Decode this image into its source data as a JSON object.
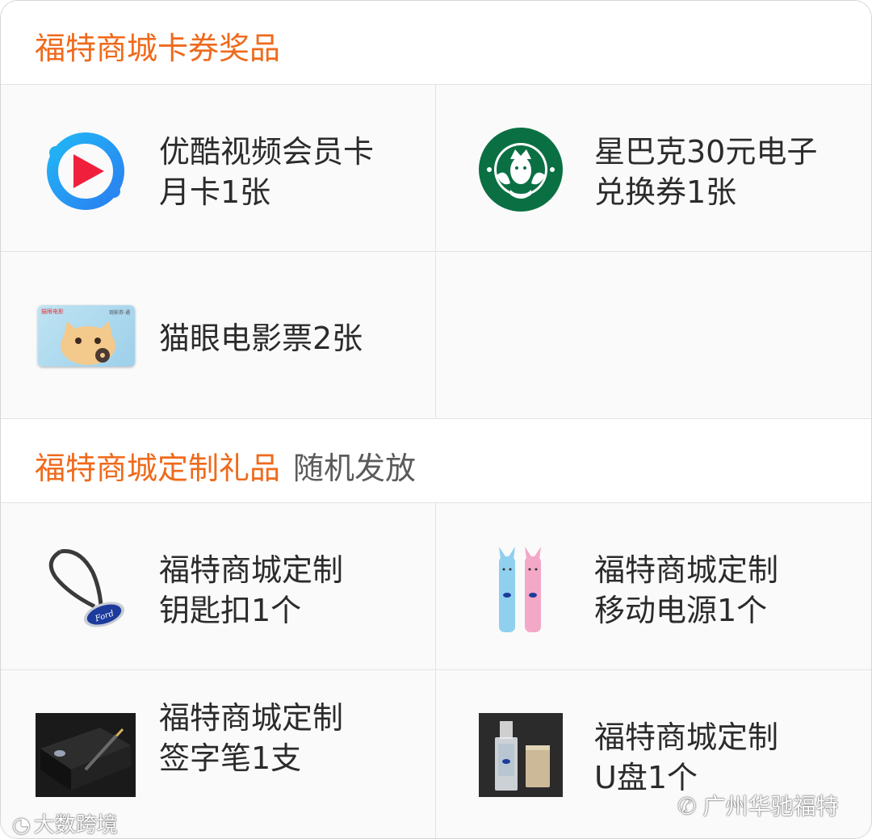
{
  "section1": {
    "title": "福特商城卡券奖品"
  },
  "cards": [
    {
      "line1": "优酷视频会员卡",
      "line2": "月卡1张",
      "icon": "youku-play-icon"
    },
    {
      "line1": "星巴克30元电子",
      "line2": "兑换券1张",
      "icon": "starbucks-logo-icon"
    },
    {
      "line1": "猫眼电影票2张",
      "line2": "",
      "icon": "maoyan-ticket-icon"
    }
  ],
  "section2": {
    "title": "福特商城定制礼品",
    "subtitle": "随机发放"
  },
  "gifts": [
    {
      "line1": "福特商城定制",
      "line2": "钥匙扣1个",
      "icon": "keychain-icon"
    },
    {
      "line1": "福特商城定制",
      "line2": "移动电源1个",
      "icon": "power-bank-icon"
    },
    {
      "line1": "福特商城定制",
      "line2": "签字笔1支",
      "icon": "pen-icon"
    },
    {
      "line1": "福特商城定制",
      "line2": "U盘1个",
      "icon": "usb-drive-icon"
    }
  ],
  "maoyan_card_text": {
    "brand": "猫眼电影",
    "corner": "观影券·通"
  },
  "watermarks": {
    "left": "大数跨境",
    "right": "广州华驰福特"
  }
}
